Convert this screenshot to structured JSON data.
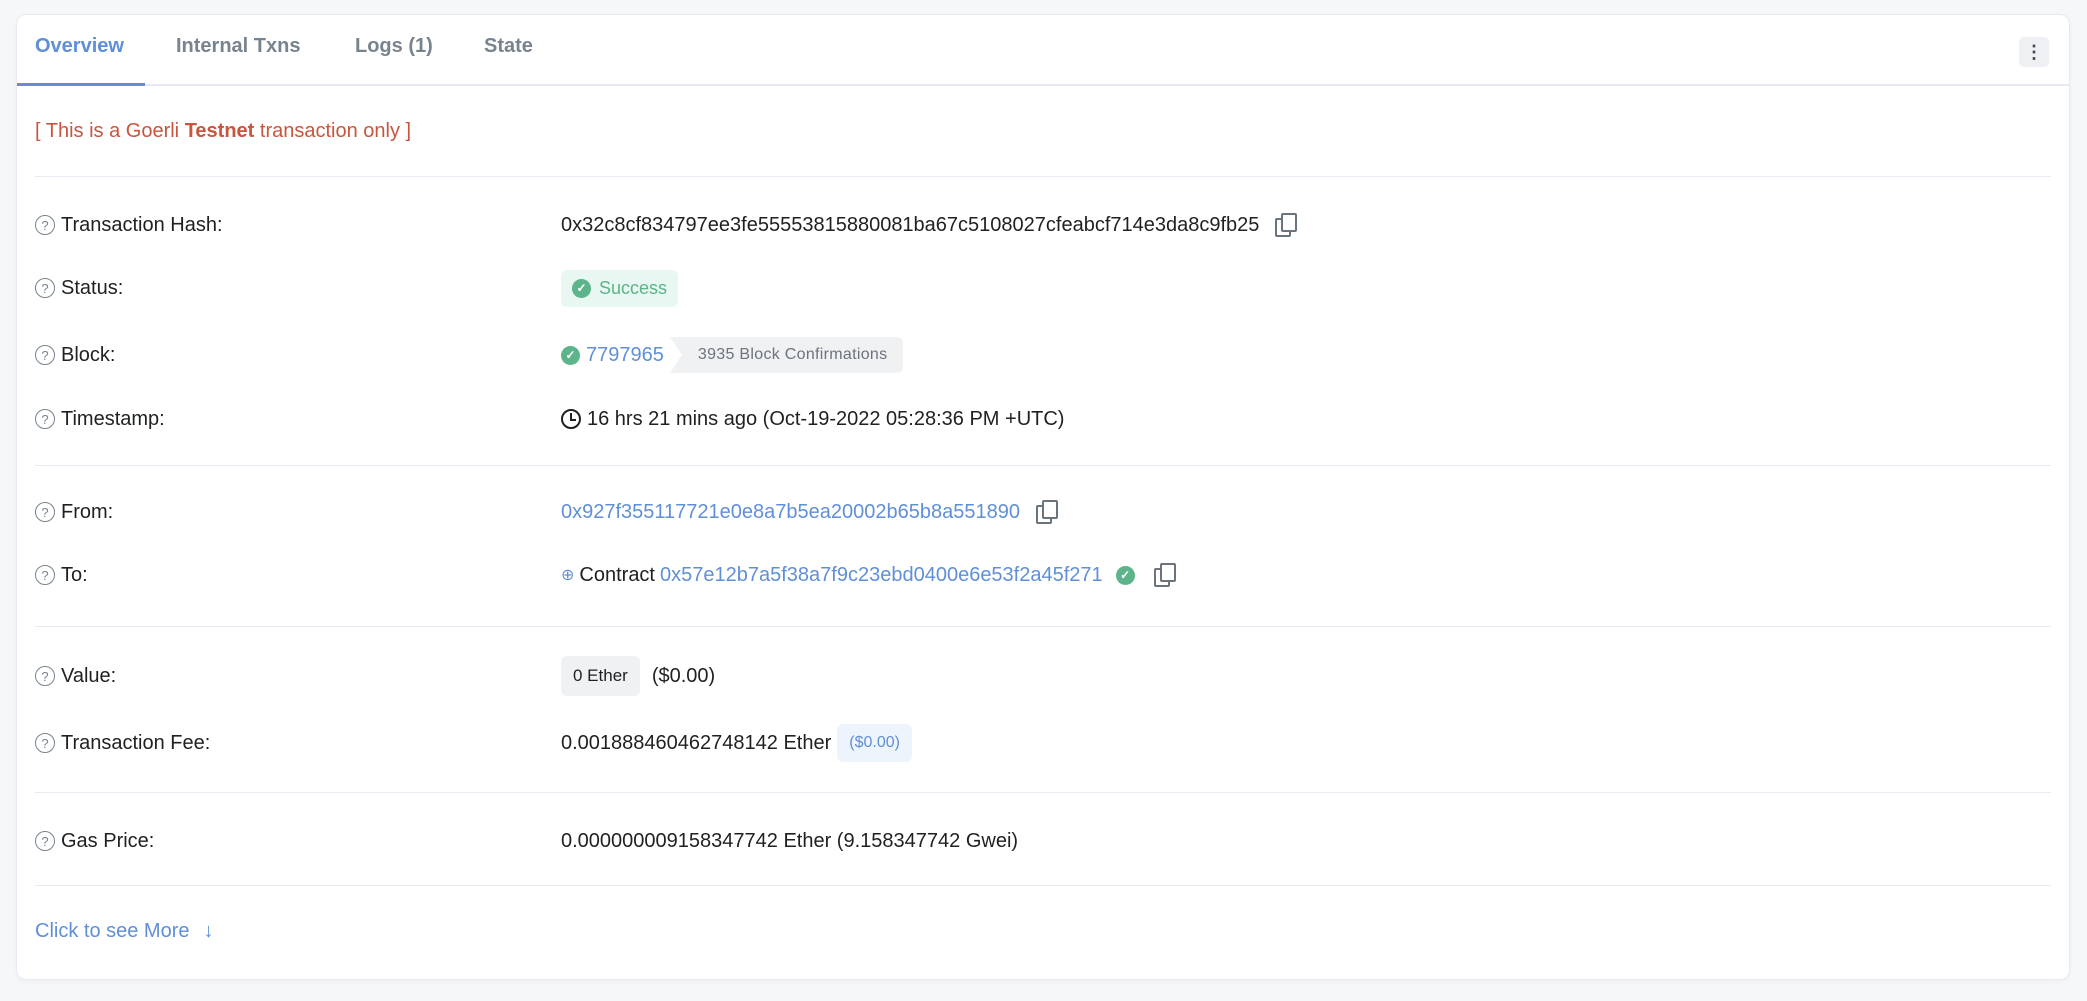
{
  "tabs": [
    {
      "label": "Overview",
      "active": true
    },
    {
      "label": "Internal Txns"
    },
    {
      "label": "Logs (1)"
    },
    {
      "label": "State"
    }
  ],
  "menu_icon": "vertical-dots-icon",
  "notice": {
    "prefix": "[ This is a Goerli ",
    "bold": "Testnet",
    "suffix": " transaction only ]"
  },
  "fields": {
    "hash": {
      "label": "Transaction Hash:",
      "value": "0x32c8cf834797ee3fe55553815880081ba67c5108027cfeabcf714e3da8c9fb25"
    },
    "status": {
      "label": "Status:",
      "value": "Success"
    },
    "block": {
      "label": "Block:",
      "value": "7797965",
      "confirmations": "3935 Block Confirmations"
    },
    "timestamp": {
      "label": "Timestamp:",
      "value": "16 hrs 21 mins ago (Oct-19-2022 05:28:36 PM +UTC)"
    },
    "from": {
      "label": "From:",
      "value": "0x927f355117721e0e8a7b5ea20002b65b8a551890"
    },
    "to": {
      "label": "To:",
      "prefix": "Contract",
      "value": "0x57e12b7a5f38a7f9c23ebd0400e6e53f2a45f271"
    },
    "value": {
      "label": "Value:",
      "amount": "0 Ether",
      "usd": "($0.00)"
    },
    "fee": {
      "label": "Transaction Fee:",
      "amount": "0.001888460462748142 Ether",
      "usd": "($0.00)"
    },
    "gas": {
      "label": "Gas Price:",
      "value": "0.000000009158347742 Ether (9.158347742 Gwei)"
    }
  },
  "see_more": "Click to see More",
  "colors": {
    "accent": "#5f8fd7",
    "success": "#5bb48a",
    "testnet": "#c8553d"
  }
}
